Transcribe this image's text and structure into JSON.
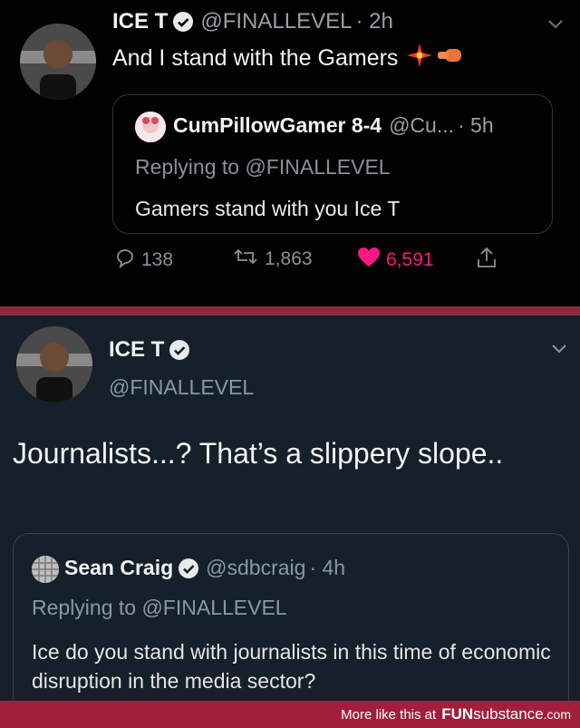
{
  "top_tweet": {
    "name": "ICE T",
    "handle": "@FINALLEVEL",
    "time": "· 2h",
    "text": "And I stand with the Gamers",
    "quoted": {
      "name": "CumPillowGamer 8-4",
      "handle": "@Cu...",
      "time": "· 5h",
      "replying": "Replying to @FINALLEVEL",
      "text": "Gamers stand with you Ice T"
    },
    "actions": {
      "replies": "138",
      "retweets": "1,863",
      "likes": "6,591"
    }
  },
  "bottom_tweet": {
    "name": "ICE T",
    "handle": "@FINALLEVEL",
    "text": "Journalists...? That’s a slippery slope..",
    "quoted": {
      "name": "Sean Craig",
      "handle": "@sdbcraig",
      "time": "· 4h",
      "replying": "Replying to @FINALLEVEL",
      "text": "Ice do you stand with journalists in this time of economic disruption in the media sector?"
    }
  },
  "footer": {
    "text": "More like this at",
    "brand_bold": "FUN",
    "brand_light": "substance",
    "brand_tld": ".com"
  },
  "colors": {
    "like": "#f91880",
    "divider": "#8b2b3f",
    "footer": "#a11f3a",
    "dim_bg": "#15202b"
  },
  "icons": [
    "verified-badge-icon",
    "chevron-down-icon",
    "reply-icon",
    "retweet-icon",
    "heart-icon",
    "share-icon",
    "sparkle-emoji-icon",
    "fist-emoji-icon"
  ]
}
